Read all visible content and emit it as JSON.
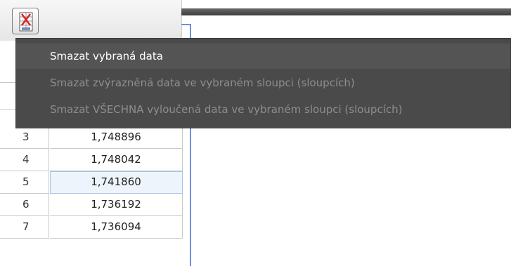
{
  "context_menu": {
    "items": [
      {
        "label": "Smazat vybraná data",
        "enabled": true
      },
      {
        "label": "Smazat zvýrazněná data ve vybraném sloupci (sloupcích)",
        "enabled": false
      },
      {
        "label": "Smazat VŠECHNA vyloučená data ve vybraném sloupci (sloupcích)",
        "enabled": false
      }
    ]
  },
  "table": {
    "rows": [
      {
        "index": "3",
        "value": "1,748896"
      },
      {
        "index": "4",
        "value": "1,748042"
      },
      {
        "index": "5",
        "value": "1,741860",
        "selected": true
      },
      {
        "index": "6",
        "value": "1,736192"
      },
      {
        "index": "7",
        "value": "1,736094"
      }
    ]
  },
  "colors": {
    "menu_background": "#4a4a4a",
    "accent_blue": "#6d8fdc"
  }
}
